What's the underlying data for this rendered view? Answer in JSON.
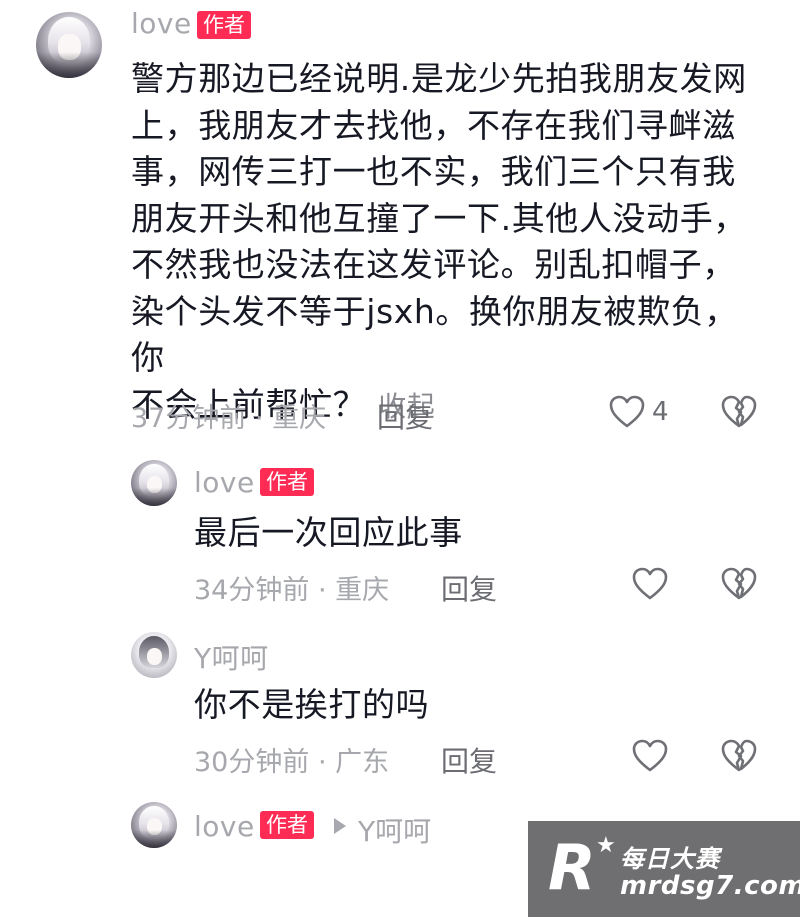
{
  "comments": [
    {
      "user": "love",
      "badge": "作者",
      "text_lines": [
        "警方那边已经说明.是龙少先拍我朋友发网",
        "上，我朋友才去找他，不存在我们寻衅滋",
        "事，网传三打一也不实，我们三个只有我",
        "朋友开头和他互撞了一下.其他人没动手，",
        "不然我也没法在这发评论。别乱扣帽子，",
        "染个头发不等于jsxh。换你朋友被欺负，你",
        "不会上前帮忙？"
      ],
      "collapse_label": "收起",
      "meta": "37分钟前 · 重庆",
      "reply_label": "回复",
      "like_count": "4"
    },
    {
      "user": "love",
      "badge": "作者",
      "text": "最后一次回应此事",
      "meta": "34分钟前 · 重庆",
      "reply_label": "回复"
    },
    {
      "user": "Y呵呵",
      "text": "你不是挨打的吗",
      "meta": "30分钟前 · 广东",
      "reply_label": "回复"
    },
    {
      "user": "love",
      "badge": "作者",
      "reply_to": "Y呵呵"
    }
  ],
  "watermark": {
    "logo": "R",
    "name": "每日大赛",
    "url": "mrdsg7.com"
  },
  "colors": {
    "badge": "#fe2c55",
    "text": "#161823",
    "meta": "#a7a8ad",
    "icon": "#7a7b80"
  },
  "icons": [
    "heart-icon",
    "broken-heart-icon",
    "reply-arrow-icon"
  ]
}
